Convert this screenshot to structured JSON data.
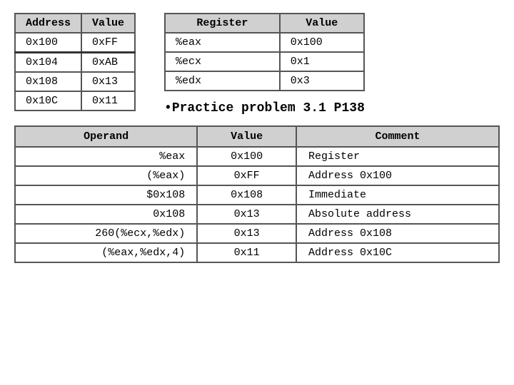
{
  "addr_table": {
    "headers": [
      "Address",
      "Value"
    ],
    "rows": [
      [
        "0x100",
        "0xFF"
      ],
      [
        "0x104",
        "0xAB"
      ],
      [
        "0x108",
        "0x13"
      ],
      [
        "0x10C",
        "0x11"
      ]
    ]
  },
  "reg_table": {
    "headers": [
      "Register",
      "Value"
    ],
    "rows": [
      [
        "%eax",
        "0x100"
      ],
      [
        "%ecx",
        "0x1"
      ],
      [
        "%edx",
        "0x3"
      ]
    ]
  },
  "practice_text": "•Practice problem 3.1  P138",
  "operand_table": {
    "headers": [
      "Operand",
      "Value",
      "Comment"
    ],
    "rows": [
      [
        "%eax",
        "0x100",
        "Register"
      ],
      [
        "(%eax)",
        "0xFF",
        "Address 0x100"
      ],
      [
        "$0x108",
        "0x108",
        "Immediate"
      ],
      [
        "0x108",
        "0x13",
        "Absolute address"
      ],
      [
        "260(%ecx,%edx)",
        "0x13",
        "Address 0x108"
      ],
      [
        "(%eax,%edx,4)",
        "0x11",
        "Address 0x10C"
      ]
    ]
  }
}
